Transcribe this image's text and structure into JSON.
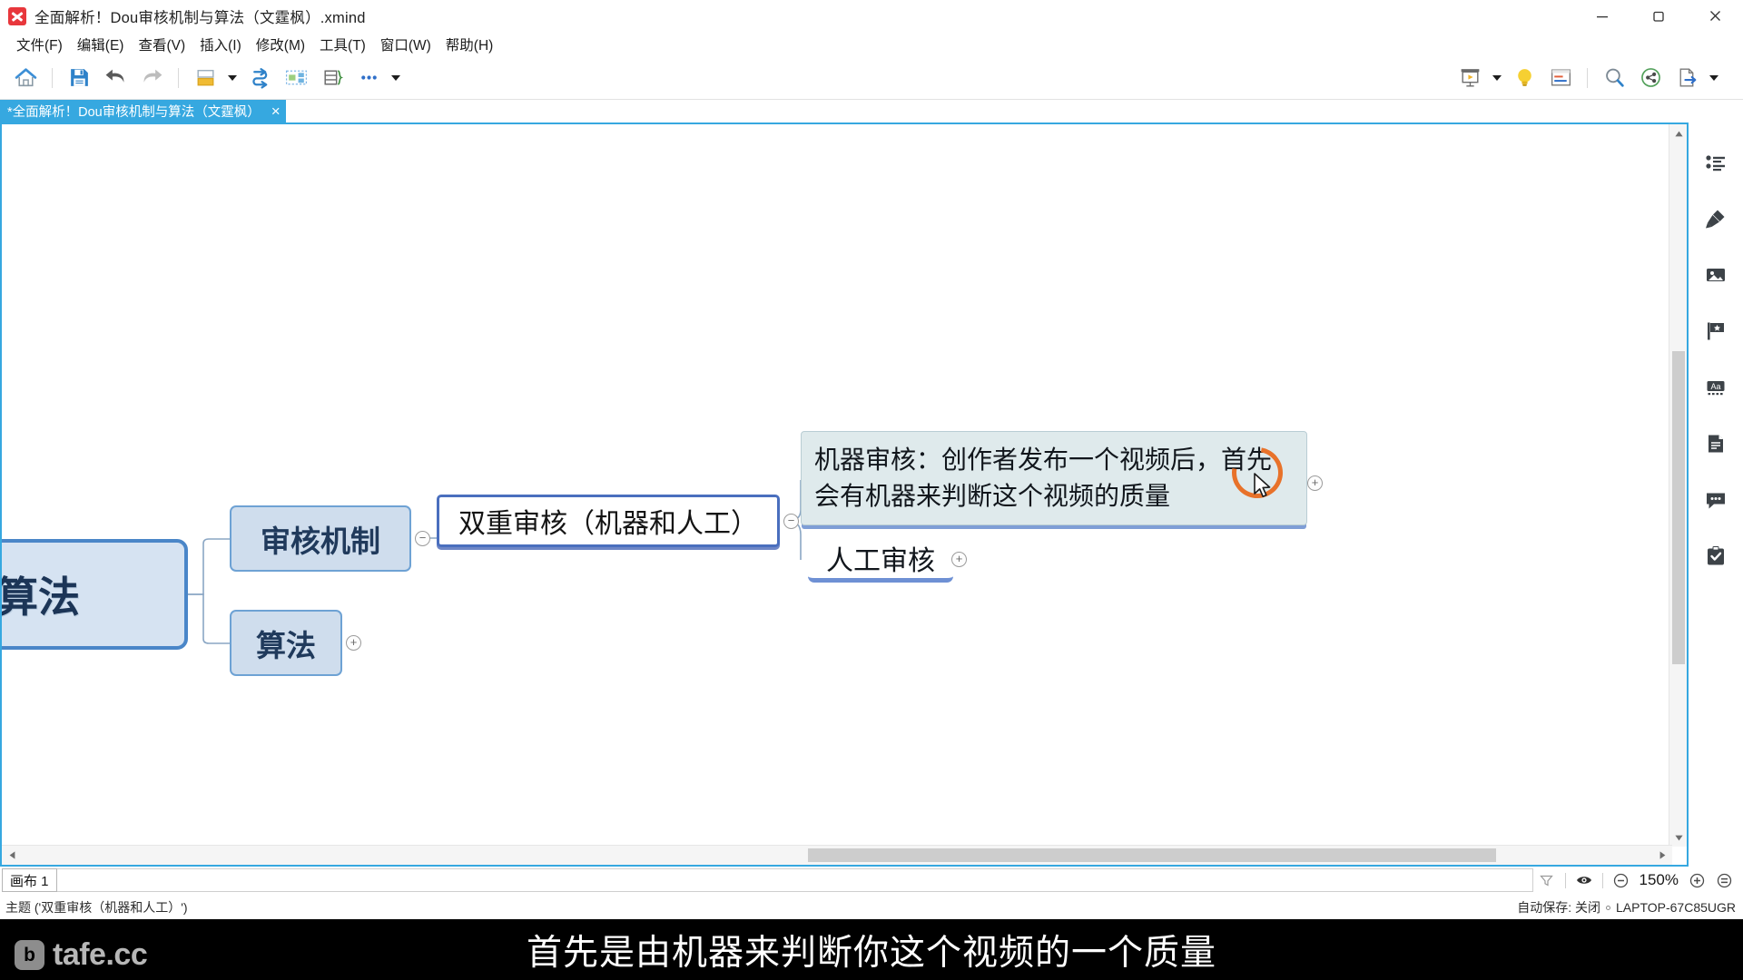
{
  "window": {
    "title": "全面解析！Dou审核机制与算法（文霆枫）.xmind",
    "app_icon": "xmind-logo-icon",
    "minimize": "minimize-button",
    "maximize": "maximize-button",
    "close": "close-button"
  },
  "menu": {
    "items": [
      {
        "label": "文件(F)",
        "name": "menu-file"
      },
      {
        "label": "编辑(E)",
        "name": "menu-edit"
      },
      {
        "label": "查看(V)",
        "name": "menu-view"
      },
      {
        "label": "插入(I)",
        "name": "menu-insert"
      },
      {
        "label": "修改(M)",
        "name": "menu-modify"
      },
      {
        "label": "工具(T)",
        "name": "menu-tools"
      },
      {
        "label": "窗口(W)",
        "name": "menu-window"
      },
      {
        "label": "帮助(H)",
        "name": "menu-help"
      }
    ]
  },
  "toolbar": {
    "left": [
      "home-icon",
      "save-icon",
      "undo-icon",
      "redo-icon",
      "topic-icon",
      "chevron-down-icon",
      "relationship-icon",
      "boundary-icon",
      "summary-icon",
      "more-icon",
      "chevron-down-icon"
    ],
    "right": [
      "presentation-icon",
      "chevron-down-icon",
      "lightbulb-icon",
      "outline-icon",
      "zoom-search-icon",
      "share-icon",
      "export-icon",
      "chevron-down-icon"
    ]
  },
  "tab": {
    "label": "*全面解析！Dou审核机制与算法（文霆枫）",
    "close_label": "×"
  },
  "mindmap": {
    "nodes": [
      {
        "id": "root",
        "label": "与算法",
        "name": "mindmap-root-node"
      },
      {
        "id": "shenhe",
        "label": "审核机制",
        "name": "mindmap-node-shenhejizhi"
      },
      {
        "id": "suanfa",
        "label": "算法",
        "name": "mindmap-node-suanfa"
      },
      {
        "id": "shuang",
        "label": "双重审核（机器和人工）",
        "name": "mindmap-node-shuangchongshenhe"
      },
      {
        "id": "jiqi",
        "label": "机器审核：创作者发布一个视频后，首先会有机器来判断这个视频的质量",
        "name": "mindmap-node-jiqishenhe"
      },
      {
        "id": "rengong",
        "label": "人工审核",
        "name": "mindmap-node-rengongshenhe"
      }
    ],
    "toggles": {
      "collapse": "−",
      "expand": "+"
    },
    "annotation": "orange-circle-highlight",
    "cursor": "mouse-pointer-icon"
  },
  "rail": {
    "items": [
      {
        "name": "rail-outline-icon",
        "icon": "outline-icon"
      },
      {
        "name": "rail-style-icon",
        "icon": "brush-icon"
      },
      {
        "name": "rail-image-icon",
        "icon": "image-icon"
      },
      {
        "name": "rail-marker-icon",
        "icon": "flag-icon"
      },
      {
        "name": "rail-text-icon",
        "icon": "aa-text-icon"
      },
      {
        "name": "rail-notes-icon",
        "icon": "notes-icon"
      },
      {
        "name": "rail-comment-icon",
        "icon": "comment-icon"
      },
      {
        "name": "rail-task-icon",
        "icon": "clipboard-check-icon"
      }
    ]
  },
  "statusbar": {
    "sheet_tab": "画布 1",
    "filter_icon": "filter-icon",
    "eye_icon": "eye-icon",
    "zoom_out": "−",
    "zoom_level": "150%",
    "zoom_in": "+",
    "fit_icon": "fit-to-screen-icon",
    "selection_info": "主题 ('双重审核（机器和人工）')",
    "autosave": "自动保存: 关闭",
    "device": "LAPTOP-67C85UGR"
  },
  "subtitle": {
    "text": "首先是由机器来判断你这个视频的一个质量",
    "watermark_text": "tafe.cc",
    "watermark_badge": "b"
  },
  "colors": {
    "tab_blue": "#36a8e0",
    "node_fill": "#cfdded",
    "node_border": "#6ea2d4",
    "selected_border": "#4a6fbe",
    "annotation_orange": "#e8722a",
    "root_border": "#4a86c8"
  }
}
